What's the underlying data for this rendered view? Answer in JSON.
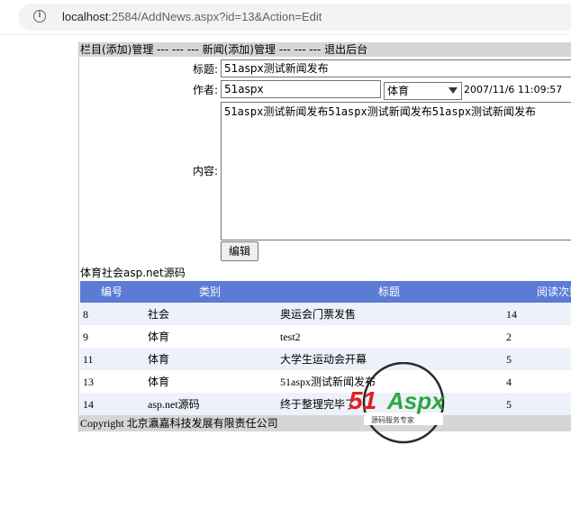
{
  "browser": {
    "info_glyph": "i",
    "url_host": "localhost",
    "url_rest": ":2584/AddNews.aspx?id=13&Action=Edit"
  },
  "nav": {
    "text": "栏目(添加)管理 --- --- --- 新闻(添加)管理 --- --- --- 退出后台"
  },
  "form": {
    "title_label": "标题:",
    "title_value": "51aspx测试新闻发布",
    "author_label": "作者:",
    "author_value": "51aspx",
    "category_selected": "体育",
    "date": "2007/11/6 11:09:57",
    "content_label": "内容:",
    "content_value": "51aspx测试新闻发布51aspx测试新闻发布51aspx测试新闻发布",
    "edit_button": "编辑"
  },
  "category_links": "体育社会asp.net源码",
  "table": {
    "headers": [
      "编号",
      "类别",
      "标题",
      "阅读次数"
    ],
    "rows": [
      [
        "8",
        "社会",
        "奥运会门票发售",
        "14"
      ],
      [
        "9",
        "体育",
        "test2",
        "2"
      ],
      [
        "11",
        "体育",
        "大学生运动会开幕",
        "5"
      ],
      [
        "13",
        "体育",
        "51aspx测试新闻发布",
        "4"
      ],
      [
        "14",
        "asp.net源码",
        "终于整理完毕了",
        "5"
      ]
    ],
    "header_color": "#5b7bd5",
    "stripe_color": "#eef0fa"
  },
  "footer": "Copyright 北京瀛嘉科技发展有限责任公司",
  "watermark": {
    "brand_51": "51",
    "brand_aspx": "Aspx",
    "slogan": "源码服务专家"
  }
}
